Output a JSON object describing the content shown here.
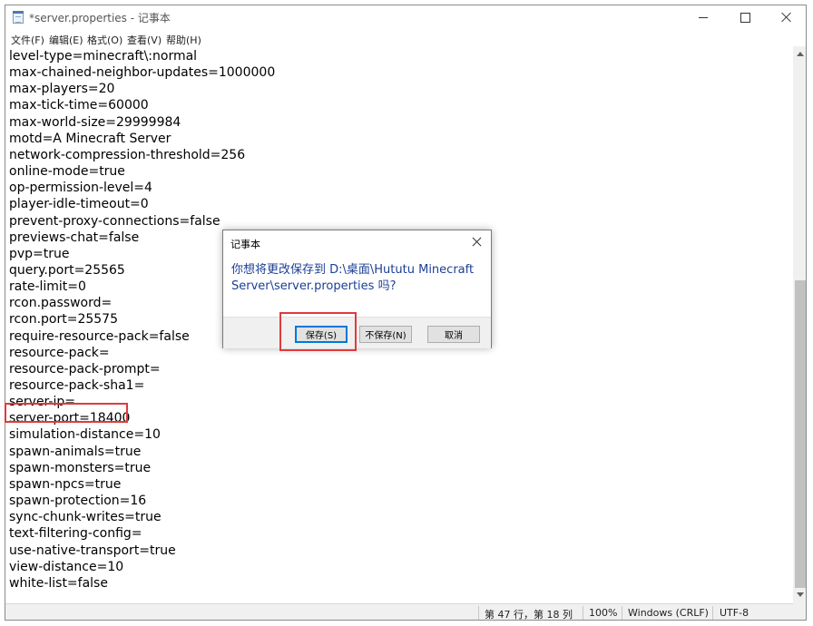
{
  "window": {
    "title": "*server.properties - 记事本"
  },
  "menu": [
    "文件(F)",
    "编辑(E)",
    "格式(O)",
    "查看(V)",
    "帮助(H)"
  ],
  "editor_lines": [
    "level-type=minecraft\\:normal",
    "max-chained-neighbor-updates=1000000",
    "max-players=20",
    "max-tick-time=60000",
    "max-world-size=29999984",
    "motd=A Minecraft Server",
    "network-compression-threshold=256",
    "online-mode=true",
    "op-permission-level=4",
    "player-idle-timeout=0",
    "prevent-proxy-connections=false",
    "previews-chat=false",
    "pvp=true",
    "query.port=25565",
    "rate-limit=0",
    "rcon.password=",
    "rcon.port=25575",
    "require-resource-pack=false",
    "resource-pack=",
    "resource-pack-prompt=",
    "resource-pack-sha1=",
    "server-ip=",
    "server-port=18400",
    "simulation-distance=10",
    "spawn-animals=true",
    "spawn-monsters=true",
    "spawn-npcs=true",
    "spawn-protection=16",
    "sync-chunk-writes=true",
    "text-filtering-config=",
    "use-native-transport=true",
    "view-distance=10",
    "white-list=false"
  ],
  "statusbar": {
    "position": "第 47 行，第 18 列",
    "zoom": "100%",
    "line_ending": "Windows (CRLF)",
    "encoding": "UTF-8"
  },
  "dialog": {
    "title": "记事本",
    "message": "你想将更改保存到 D:\\桌面\\Hututu Minecraft Server\\server.properties 吗?",
    "save_label": "保存(S)",
    "dont_save_label": "不保存(N)",
    "cancel_label": "取消"
  },
  "colors": {
    "highlight": "#e03a3a",
    "dialog_message": "#1c3f95",
    "focus_blue": "#0078d7"
  }
}
